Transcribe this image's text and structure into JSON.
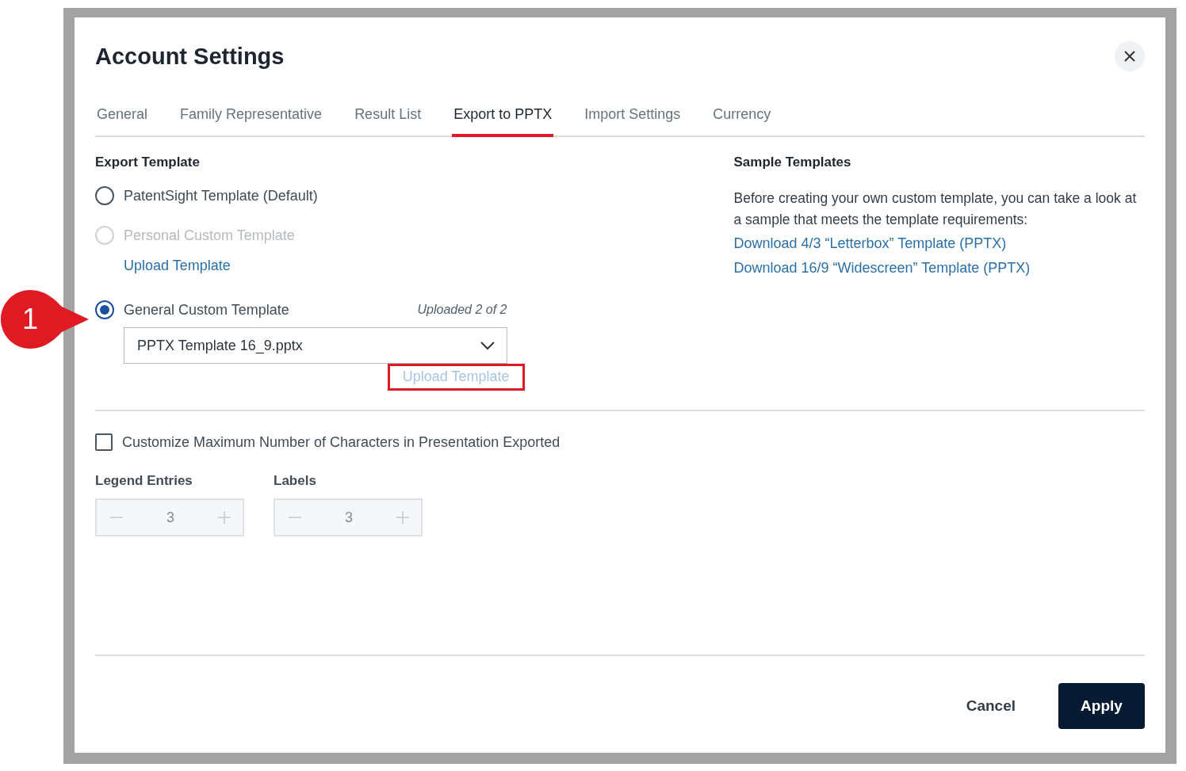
{
  "dialog": {
    "title": "Account Settings"
  },
  "tabs": [
    {
      "label": "General",
      "selected": false
    },
    {
      "label": "Family Representative",
      "selected": false
    },
    {
      "label": "Result List",
      "selected": false
    },
    {
      "label": "Export to PPTX",
      "selected": true
    },
    {
      "label": "Import Settings",
      "selected": false
    },
    {
      "label": "Currency",
      "selected": false
    }
  ],
  "export_template": {
    "heading": "Export Template",
    "options": [
      {
        "label": "PatentSight Template (Default)",
        "selected": false,
        "disabled": false
      },
      {
        "label": "Personal Custom Template",
        "selected": false,
        "disabled": true,
        "upload_link": {
          "label": "Upload Template",
          "disabled": false,
          "highlighted": false
        }
      },
      {
        "label": "General Custom Template",
        "selected": true,
        "disabled": false,
        "upload_count": "Uploaded 2 of 2",
        "dropdown": {
          "value": "PPTX Template 16_9.pptx"
        },
        "upload_link": {
          "label": "Upload Template",
          "disabled": true,
          "highlighted": true
        }
      }
    ]
  },
  "sample_templates": {
    "heading": "Sample Templates",
    "text": "Before creating your own custom template, you can take a look at a sample that meets the template requirements:",
    "links": [
      "Download 4/3 “Letterbox” Template (PPTX)",
      "Download 16/9 “Widescreen” Template (PPTX)"
    ]
  },
  "customize": {
    "label": "Customize Maximum Number of Characters in Presentation Exported",
    "checked": false
  },
  "steppers": [
    {
      "label": "Legend Entries",
      "value": "3",
      "disabled": true
    },
    {
      "label": "Labels",
      "value": "3",
      "disabled": true
    }
  ],
  "footer": {
    "cancel": "Cancel",
    "apply": "Apply"
  },
  "callout": {
    "label": "1"
  }
}
